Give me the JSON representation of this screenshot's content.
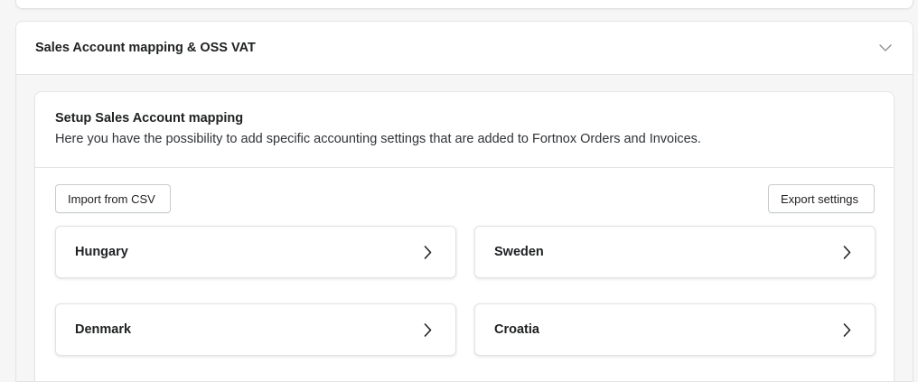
{
  "section": {
    "title": "Sales Account mapping & OSS VAT",
    "collapse_icon": "chevron-down-icon"
  },
  "mapping": {
    "title": "Setup Sales Account mapping",
    "description": "Here you have the possibility to add specific accounting settings that are added to Fortnox Orders and Invoices.",
    "import_label": "Import from CSV",
    "export_label": "Export settings",
    "countries": [
      {
        "label": "Hungary",
        "icon": "chevron-right-icon"
      },
      {
        "label": "Sweden",
        "icon": "chevron-right-icon"
      },
      {
        "label": "Denmark",
        "icon": "chevron-right-icon"
      },
      {
        "label": "Croatia",
        "icon": "chevron-right-icon"
      }
    ]
  },
  "colors": {
    "background": "#f6f6f7",
    "card": "#ffffff",
    "border": "#e1e3e5",
    "text": "#202223"
  }
}
